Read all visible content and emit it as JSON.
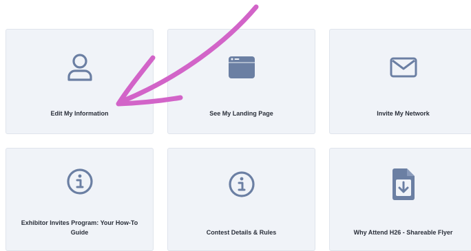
{
  "cards": [
    {
      "label": "Edit My Information",
      "icon": "user-icon"
    },
    {
      "label": "See My Landing Page",
      "icon": "browser-window-icon"
    },
    {
      "label": "Invite My Network",
      "icon": "envelope-icon"
    },
    {
      "label": "Exhibitor Invites Program: Your How-To Guide",
      "icon": "info-icon"
    },
    {
      "label": "Contest Details & Rules",
      "icon": "info-icon"
    },
    {
      "label": "Why Attend H26 - Shareable Flyer",
      "icon": "file-download-icon"
    }
  ],
  "colors": {
    "card_bg": "#f0f3f8",
    "icon": "#6b7fa3",
    "annotation_arrow": "#d264c8"
  }
}
